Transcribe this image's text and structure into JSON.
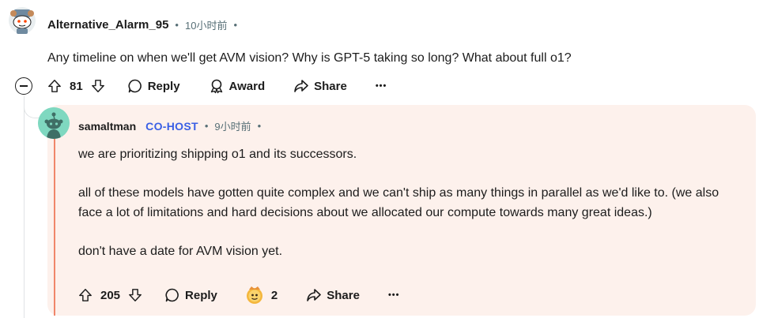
{
  "parent": {
    "username": "Alternative_Alarm_95",
    "dot1": "•",
    "time": "10小时前",
    "dot2": "•",
    "text": "Any timeline on when we'll get AVM vision? Why is GPT-5 taking so long? What about full o1?",
    "votes": "81",
    "reply_label": "Reply",
    "award_label": "Award",
    "share_label": "Share",
    "more_label": "•••"
  },
  "reply": {
    "username": "samaltman",
    "flair": "CO-HOST",
    "dot1": "•",
    "time": "9小时前",
    "dot2": "•",
    "paragraphs": [
      "we are prioritizing shipping o1 and its successors.",
      "all of these models have gotten quite complex and we can't ship as many things in parallel as we'd like to. (we also face a lot of limitations and hard decisions about we allocated our compute towards many great ideas.)",
      "don't have a date for AVM vision yet."
    ],
    "votes": "205",
    "reply_label": "Reply",
    "award_count": "2",
    "share_label": "Share",
    "more_label": "•••"
  },
  "icons": {
    "upvote": "arrow-up-icon",
    "downvote": "arrow-down-icon",
    "reply": "speech-bubble-icon",
    "award": "award-ribbon-icon",
    "share": "share-arrow-icon",
    "collapse": "minus-circle-icon"
  },
  "colors": {
    "card_bg": "#fdf1ec",
    "accent_line": "#f0866a",
    "cohost": "#3a5fe5",
    "meta": "#576f76"
  }
}
